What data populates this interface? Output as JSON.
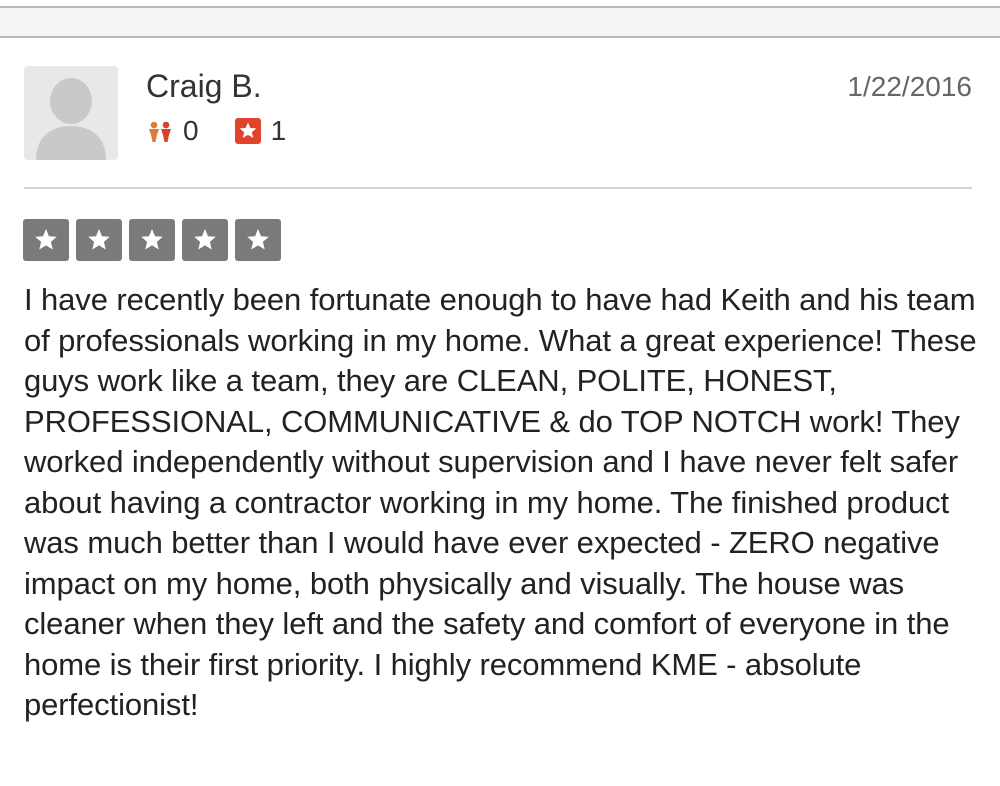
{
  "review": {
    "user_name": "Craig B.",
    "date": "1/22/2016",
    "friends_count": "0",
    "reviews_count": "1",
    "rating": 5,
    "text": "I have recently been fortunate enough to have had Keith and his team of professionals working in my home. What a great experience! These guys work like a team, they are CLEAN, POLITE, HONEST, PROFESSIONAL, COMMUNICATIVE & do TOP NOTCH work! They worked independently without supervision and I have never felt safer about having a contractor working in my home. The finished product was much better than I would have ever expected - ZERO negative impact on my home, both physically and visually. The house was cleaner when they left and the safety and comfort of everyone in the home is their first priority. I highly recommend KME - absolute perfectionist!"
  },
  "icons": {
    "avatar": "default-user-avatar-icon",
    "friends": "friends-icon",
    "reviews": "review-count-star-icon",
    "rating_star": "star-icon"
  },
  "colors": {
    "brand_red": "#e0442b",
    "friends_icon": "#e07a3a",
    "rating_box": "#7a7a7a",
    "text": "#222222",
    "date": "#666666"
  }
}
